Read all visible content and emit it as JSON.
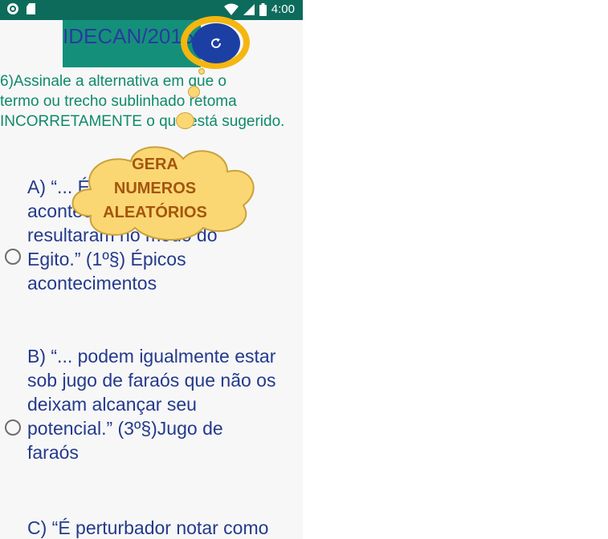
{
  "status_bar": {
    "time": "4:00"
  },
  "header": {
    "title": "IDECAN/2016"
  },
  "question": {
    "text": "6)Assinale a alternativa em que o\ntermo ou trecho sublinhado retoma\nINCORRETAMENTE o que está sugerido."
  },
  "callout": {
    "text": "GERA\nNUMEROS\nALEATÓRIOS"
  },
  "options": [
    {
      "text": "A) “... Épicos\nacontecimentos\nresultaram no modo do\nEgito.” (1º§) Épicos\nacontecimentos"
    },
    {
      "text": "B) “... podem igualmente estar\nsob jugo de faraós que não os\ndeixam alcançar seu\npotencial.” (3º§)Jugo de\nfaraós"
    },
    {
      "text": "C) “É perturbador notar como"
    }
  ],
  "colors": {
    "status_bar": "#0d6b5b",
    "header": "#14907a",
    "fab": "#1b3fa3",
    "fab_ring": "#f5b60f",
    "cloud": "#fbd773",
    "question_text": "#0f8a6a",
    "option_text": "#233a8c"
  },
  "icons": {
    "fab": "refresh-icon",
    "status_left": [
      "circle-icon",
      "sd-card-icon"
    ],
    "status_right": [
      "wifi-icon",
      "signal-icon",
      "battery-icon"
    ]
  }
}
